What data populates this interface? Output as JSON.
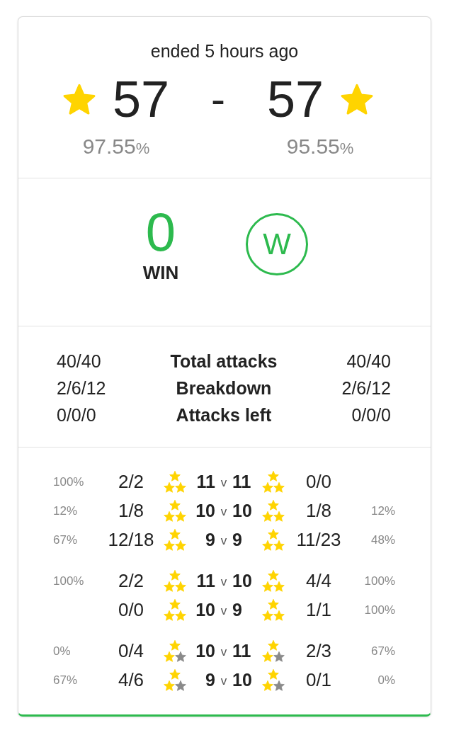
{
  "summary": {
    "status": "ended 5 hours ago",
    "home": {
      "score": "57",
      "rate": "97.55",
      "unit": "%"
    },
    "separator": "-",
    "away": {
      "score": "57",
      "rate": "95.55",
      "unit": "%"
    }
  },
  "result": {
    "kind": "win",
    "difference": "0",
    "label": "WIN",
    "badge": "W"
  },
  "totals": [
    {
      "home": "40/40",
      "label": "Total attacks",
      "away": "40/40"
    },
    {
      "home": "2/6/12",
      "label": "Breakdown",
      "away": "2/6/12"
    },
    {
      "home": "0/0/0",
      "label": "Attacks left",
      "away": "0/0/0"
    }
  ],
  "matchups": [
    {
      "rows": [
        {
          "home": {
            "rate": "100%",
            "record": "2/2",
            "kind": "triple",
            "level": "11"
          },
          "versus": "v",
          "away": {
            "level": "11",
            "kind": "triple",
            "record": "0/0"
          }
        },
        {
          "home": {
            "rate": "12%",
            "record": "1/8",
            "kind": "triple",
            "level": "10"
          },
          "versus": "v",
          "away": {
            "level": "10",
            "kind": "triple",
            "record": "1/8",
            "rate": "12%"
          }
        },
        {
          "home": {
            "rate": "67%",
            "record": "12/18",
            "kind": "triple",
            "level": "9"
          },
          "versus": "v",
          "away": {
            "level": "9",
            "kind": "triple",
            "record": "11/23",
            "rate": "48%"
          }
        }
      ]
    },
    {
      "rows": [
        {
          "home": {
            "rate": "100%",
            "record": "2/2",
            "kind": "triple",
            "level": "11"
          },
          "versus": "v",
          "away": {
            "level": "10",
            "kind": "triple",
            "record": "4/4",
            "rate": "100%"
          }
        },
        {
          "home": {
            "record": "0/0",
            "kind": "triple",
            "level": "10"
          },
          "versus": "v",
          "away": {
            "level": "9",
            "kind": "triple",
            "record": "1/1",
            "rate": "100%"
          }
        }
      ]
    },
    {
      "rows": [
        {
          "home": {
            "rate": "0%",
            "record": "0/4",
            "kind": "double",
            "level": "10"
          },
          "versus": "v",
          "away": {
            "level": "11",
            "kind": "double",
            "record": "2/3",
            "rate": "67%"
          }
        },
        {
          "home": {
            "rate": "67%",
            "record": "4/6",
            "kind": "double",
            "level": "9"
          },
          "versus": "v",
          "away": {
            "level": "10",
            "kind": "double",
            "record": "0/1",
            "rate": "0%"
          }
        }
      ]
    }
  ]
}
